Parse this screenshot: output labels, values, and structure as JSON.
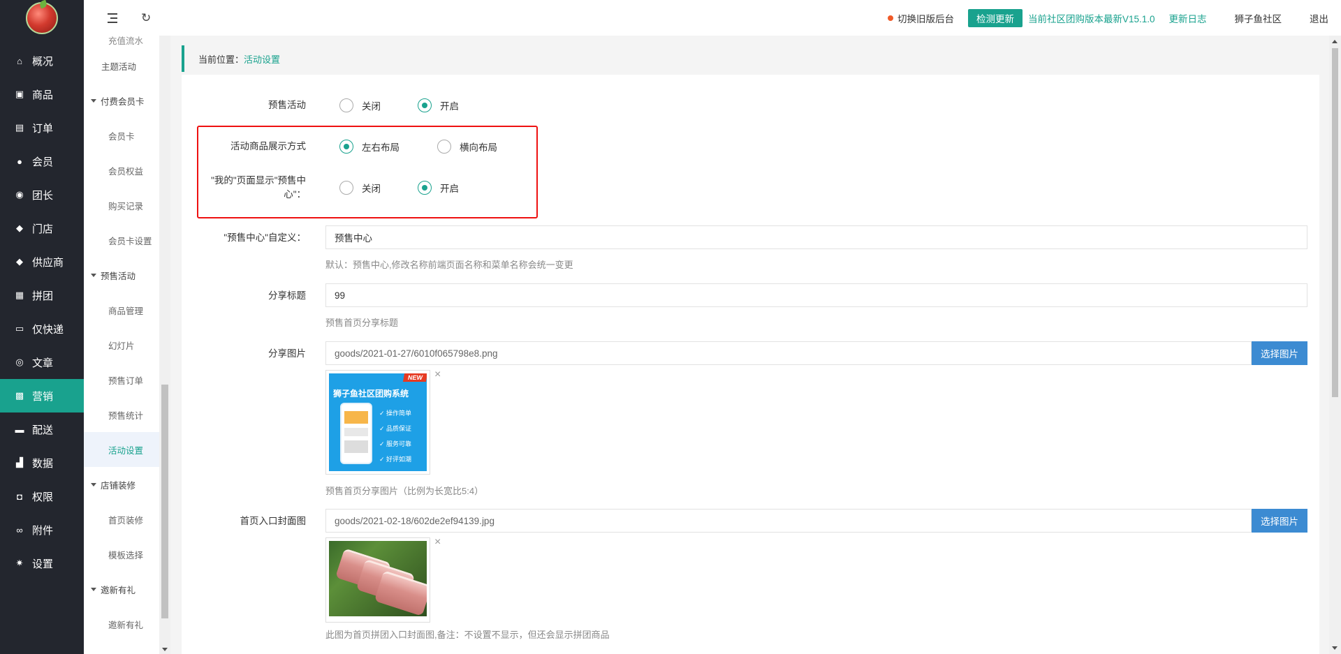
{
  "nav": [
    {
      "icon": "home-icon",
      "glyph": "⌂",
      "label": "概况"
    },
    {
      "icon": "goods-icon",
      "glyph": "▣",
      "label": "商品"
    },
    {
      "icon": "order-icon",
      "glyph": "▤",
      "label": "订单"
    },
    {
      "icon": "member-icon",
      "glyph": "●",
      "label": "会员"
    },
    {
      "icon": "leader-icon",
      "glyph": "◉",
      "label": "团长"
    },
    {
      "icon": "store-icon",
      "glyph": "◆",
      "label": "门店"
    },
    {
      "icon": "supplier-icon",
      "glyph": "◆",
      "label": "供应商"
    },
    {
      "icon": "group-icon",
      "glyph": "▦",
      "label": "拼团"
    },
    {
      "icon": "express-icon",
      "glyph": "▭",
      "label": "仅快递"
    },
    {
      "icon": "compass-icon",
      "glyph": "◎",
      "label": "文章"
    },
    {
      "icon": "gift-icon",
      "glyph": "▩",
      "label": "营销"
    },
    {
      "icon": "truck-icon",
      "glyph": "▬",
      "label": "配送"
    },
    {
      "icon": "chart-icon",
      "glyph": "▟",
      "label": "数据"
    },
    {
      "icon": "lock-icon",
      "glyph": "◘",
      "label": "权限"
    },
    {
      "icon": "link-icon",
      "glyph": "∞",
      "label": "附件"
    },
    {
      "icon": "gear-icon",
      "glyph": "✷",
      "label": "设置"
    }
  ],
  "sub_nav": {
    "clipped_top": "充值流水",
    "theme": "主题活动",
    "vip_group": "付费会员卡",
    "vip_items": [
      "会员卡",
      "会员权益",
      "购买记录",
      "会员卡设置"
    ],
    "presale_group": "预售活动",
    "presale_items": [
      "商品管理",
      "幻灯片",
      "预售订单",
      "预售统计",
      "活动设置"
    ],
    "decor_group": "店铺装修",
    "decor_items": [
      "首页装修",
      "模板选择"
    ],
    "invite_group": "邀新有礼",
    "invite_items": [
      "邀新有礼"
    ]
  },
  "header": {
    "switch_old": "切换旧版后台",
    "check_update": "检测更新",
    "version_text": "当前社区团购版本最新V15.1.0",
    "changelog": "更新日志",
    "shop_name": "狮子鱼社区",
    "logout": "退出"
  },
  "breadcrumb": {
    "prefix": "当前位置：",
    "current": "活动设置"
  },
  "form": {
    "presale": {
      "label": "预售活动",
      "off": "关闭",
      "on": "开启",
      "value": "on"
    },
    "display_mode": {
      "label": "活动商品展示方式",
      "opt1": "左右布局",
      "opt2": "横向布局",
      "value": "opt1"
    },
    "my_page": {
      "label": "\"我的\"页面显示\"预售中心\"：",
      "off": "关闭",
      "on": "开启",
      "value": "on"
    },
    "center_name": {
      "label": "\"预售中心\"自定义：",
      "value": "预售中心",
      "hint": "默认：预售中心,修改名称前端页面名称和菜单名称会统一变更"
    },
    "share_title": {
      "label": "分享标题",
      "value": "99",
      "hint": "预售首页分享标题"
    },
    "share_image": {
      "label": "分享图片",
      "path": "goods/2021-01-27/6010f065798e8.png",
      "button": "选择图片",
      "hint": "预售首页分享图片（比例为长宽比5:4）",
      "preview": {
        "badge": "NEW",
        "title": "狮子鱼社区团购系统",
        "features": [
          "✓ 操作简单",
          "✓ 品质保证",
          "✓ 服务可靠",
          "✓ 好评如潮"
        ]
      }
    },
    "cover_image": {
      "label": "首页入口封面图",
      "path": "goods/2021-02-18/602de2ef94139.jpg",
      "button": "选择图片",
      "hint": "此图为首页拼团入口封面图,备注：不设置不显示，但还会显示拼团商品"
    }
  },
  "colors": {
    "accent": "#19a28e",
    "sidebar": "#23262e",
    "button": "#3c8bd2",
    "highlight": "#ee1111"
  }
}
